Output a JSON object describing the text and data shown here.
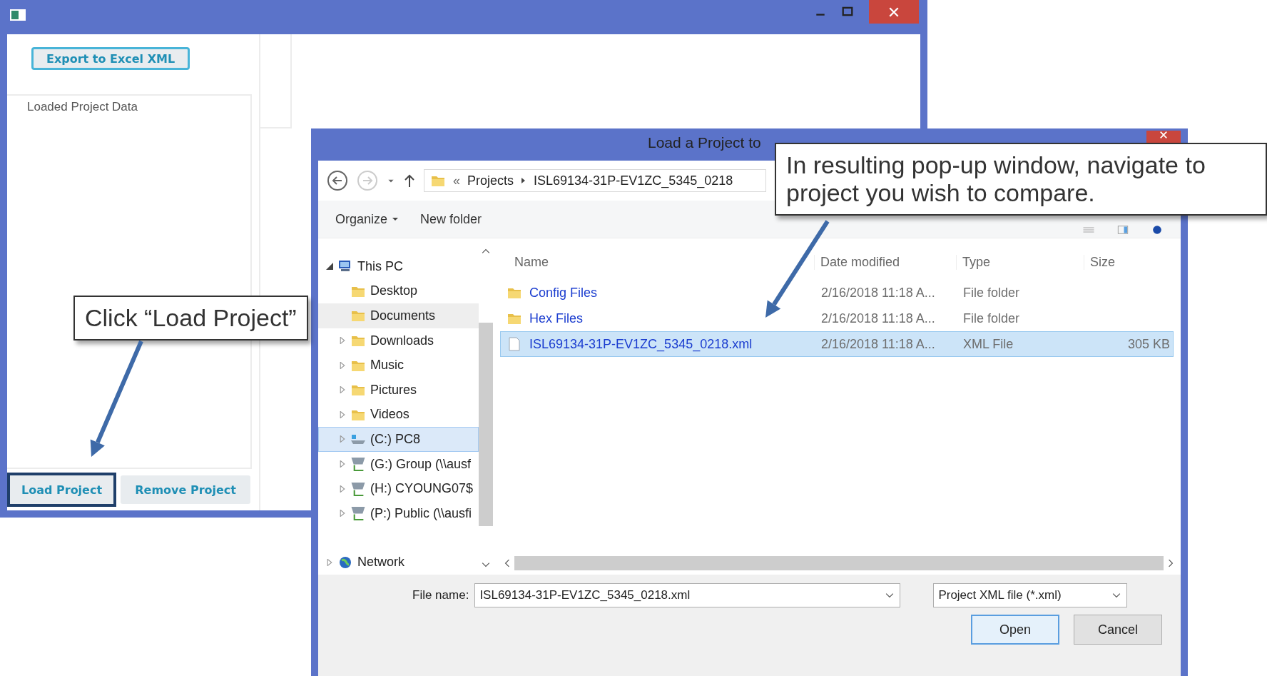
{
  "main_window": {
    "top_button": {
      "label": "Export to Excel XML"
    },
    "panel": {
      "title": "Loaded Project Data"
    },
    "bottom_buttons": [
      {
        "label": "Load Project",
        "focused": true
      },
      {
        "label": "Remove Project",
        "focused": false
      }
    ]
  },
  "dialog": {
    "title": "Load a Project to",
    "address": {
      "overflow": "«",
      "crumbs": [
        "Projects",
        "ISL69134-31P-EV1ZC_5345_0218"
      ]
    },
    "toolbar": {
      "organize": "Organize",
      "new_folder": "New folder"
    },
    "tree": [
      {
        "label": "This PC",
        "kind": "computer",
        "expanded": true,
        "selected": false,
        "hovered": false,
        "children": [
          {
            "label": "Desktop",
            "kind": "desktop",
            "selected": false,
            "hovered": false
          },
          {
            "label": "Documents",
            "kind": "documents",
            "selected": false,
            "hovered": true
          },
          {
            "label": "Downloads",
            "kind": "downloads",
            "expanded": false,
            "selected": false,
            "hovered": false
          },
          {
            "label": "Music",
            "kind": "music",
            "expanded": false,
            "selected": false,
            "hovered": false
          },
          {
            "label": "Pictures",
            "kind": "pictures",
            "expanded": false,
            "selected": false,
            "hovered": false
          },
          {
            "label": "Videos",
            "kind": "videos",
            "expanded": false,
            "selected": false,
            "hovered": false
          },
          {
            "label": "(C:) PC8",
            "kind": "drive",
            "expanded": false,
            "selected": true,
            "hovered": false
          },
          {
            "label": "(G:) Group (\\\\ausf",
            "kind": "network-drive",
            "expanded": false,
            "selected": false,
            "hovered": false
          },
          {
            "label": "(H:) CYOUNG07$",
            "kind": "network-drive",
            "expanded": false,
            "selected": false,
            "hovered": false
          },
          {
            "label": "(P:) Public (\\\\ausfi",
            "kind": "network-drive",
            "expanded": false,
            "selected": false,
            "hovered": false
          }
        ]
      },
      {
        "label": "Network",
        "kind": "network",
        "expanded": false,
        "selected": false,
        "hovered": false
      }
    ],
    "columns": [
      "Name",
      "Date modified",
      "Type",
      "Size"
    ],
    "files": [
      {
        "kind": "folder",
        "name": "Config Files",
        "date": "2/16/2018 11:18 A...",
        "type": "File folder",
        "selected": false
      },
      {
        "kind": "folder",
        "name": "Hex Files",
        "date": "2/16/2018 11:18 A...",
        "type": "File folder",
        "selected": false
      },
      {
        "kind": "file",
        "name": "ISL69134-31P-EV1ZC_5345_0218.xml",
        "date": "2/16/2018 11:18 A...",
        "type": "XML File",
        "size": "305 KB",
        "selected": true
      }
    ],
    "file_name": {
      "label": "File name:",
      "value": "ISL69134-31P-EV1ZC_5345_0218.xml"
    },
    "filter": "Project XML file (*.xml)",
    "buttons": [
      {
        "label": "Open",
        "default": true
      },
      {
        "label": "Cancel",
        "default": false
      }
    ]
  },
  "callouts": [
    {
      "text": "Click “Load Project”"
    },
    {
      "text": "In resulting pop-up window, navigate to project you wish to compare."
    }
  ]
}
